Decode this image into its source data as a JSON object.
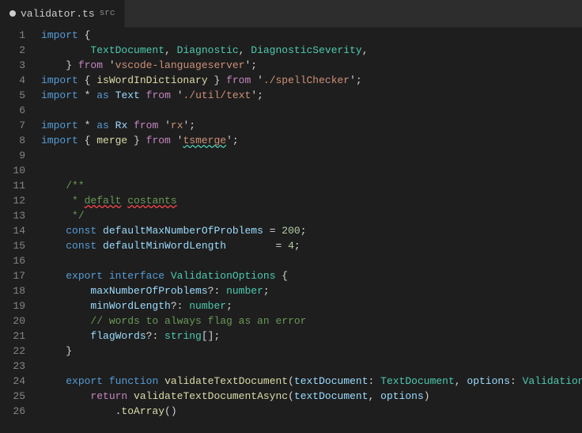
{
  "tab": {
    "dot": true,
    "filename": "validator.ts",
    "src_label": "src"
  },
  "lines": [
    {
      "num": 1,
      "tokens": [
        {
          "t": "kw",
          "v": "import"
        },
        {
          "t": "plain",
          "v": " { "
        }
      ]
    },
    {
      "num": 2,
      "tokens": [
        {
          "t": "plain",
          "v": "        "
        },
        {
          "t": "type",
          "v": "TextDocument"
        },
        {
          "t": "plain",
          "v": ", "
        },
        {
          "t": "type",
          "v": "Diagnostic"
        },
        {
          "t": "plain",
          "v": ", "
        },
        {
          "t": "type",
          "v": "DiagnosticSeverity"
        },
        {
          "t": "plain",
          "v": ","
        }
      ]
    },
    {
      "num": 3,
      "tokens": [
        {
          "t": "plain",
          "v": "    } "
        },
        {
          "t": "kw2",
          "v": "from"
        },
        {
          "t": "plain",
          "v": " '"
        },
        {
          "t": "str",
          "v": "vscode-languageserver"
        },
        {
          "t": "plain",
          "v": "';"
        }
      ]
    },
    {
      "num": 4,
      "tokens": [
        {
          "t": "kw",
          "v": "import"
        },
        {
          "t": "plain",
          "v": " { "
        },
        {
          "t": "fn",
          "v": "isWordInDictionary"
        },
        {
          "t": "plain",
          "v": " } "
        },
        {
          "t": "kw2",
          "v": "from"
        },
        {
          "t": "plain",
          "v": " '"
        },
        {
          "t": "str",
          "v": "./spellChecker"
        },
        {
          "t": "plain",
          "v": "';"
        }
      ]
    },
    {
      "num": 5,
      "tokens": [
        {
          "t": "kw",
          "v": "import"
        },
        {
          "t": "plain",
          "v": " * "
        },
        {
          "t": "kw",
          "v": "as"
        },
        {
          "t": "plain",
          "v": " "
        },
        {
          "t": "id",
          "v": "Text"
        },
        {
          "t": "plain",
          "v": " "
        },
        {
          "t": "kw2",
          "v": "from"
        },
        {
          "t": "plain",
          "v": " '"
        },
        {
          "t": "str",
          "v": "./util/text"
        },
        {
          "t": "plain",
          "v": "';"
        }
      ]
    },
    {
      "num": 6,
      "tokens": []
    },
    {
      "num": 7,
      "tokens": [
        {
          "t": "kw",
          "v": "import"
        },
        {
          "t": "plain",
          "v": " * "
        },
        {
          "t": "kw",
          "v": "as"
        },
        {
          "t": "plain",
          "v": " "
        },
        {
          "t": "id",
          "v": "Rx"
        },
        {
          "t": "plain",
          "v": " "
        },
        {
          "t": "kw2",
          "v": "from"
        },
        {
          "t": "plain",
          "v": " '"
        },
        {
          "t": "str",
          "v": "rx"
        },
        {
          "t": "plain",
          "v": "';"
        }
      ]
    },
    {
      "num": 8,
      "tokens": [
        {
          "t": "kw",
          "v": "import"
        },
        {
          "t": "plain",
          "v": " { "
        },
        {
          "t": "fn",
          "v": "merge"
        },
        {
          "t": "plain",
          "v": " } "
        },
        {
          "t": "kw2",
          "v": "from"
        },
        {
          "t": "plain",
          "v": " '"
        },
        {
          "t": "str",
          "v": "tsmerge",
          "squig": "green"
        },
        {
          "t": "plain",
          "v": "';"
        }
      ]
    },
    {
      "num": 9,
      "tokens": []
    },
    {
      "num": 10,
      "tokens": []
    },
    {
      "num": 11,
      "tokens": [
        {
          "t": "plain",
          "v": "    "
        },
        {
          "t": "comment",
          "v": "/**"
        }
      ]
    },
    {
      "num": 12,
      "tokens": [
        {
          "t": "plain",
          "v": "    "
        },
        {
          "t": "comment",
          "v": " * "
        },
        {
          "t": "comment",
          "v": "defalt",
          "squig": "red"
        },
        {
          "t": "plain",
          "v": " "
        },
        {
          "t": "comment",
          "v": "costants",
          "squig": "red"
        }
      ]
    },
    {
      "num": 13,
      "tokens": [
        {
          "t": "plain",
          "v": "    "
        },
        {
          "t": "comment",
          "v": " */"
        }
      ]
    },
    {
      "num": 14,
      "tokens": [
        {
          "t": "plain",
          "v": "    "
        },
        {
          "t": "kw",
          "v": "const"
        },
        {
          "t": "plain",
          "v": " "
        },
        {
          "t": "id",
          "v": "defaultMaxNumberOfProblems"
        },
        {
          "t": "plain",
          "v": " = "
        },
        {
          "t": "num",
          "v": "200"
        },
        {
          "t": "plain",
          "v": ";"
        }
      ]
    },
    {
      "num": 15,
      "tokens": [
        {
          "t": "plain",
          "v": "    "
        },
        {
          "t": "kw",
          "v": "const"
        },
        {
          "t": "plain",
          "v": " "
        },
        {
          "t": "id",
          "v": "defaultMinWordLength"
        },
        {
          "t": "plain",
          "v": "        = "
        },
        {
          "t": "num",
          "v": "4"
        },
        {
          "t": "plain",
          "v": ";"
        }
      ]
    },
    {
      "num": 16,
      "tokens": []
    },
    {
      "num": 17,
      "tokens": [
        {
          "t": "plain",
          "v": "    "
        },
        {
          "t": "kw",
          "v": "export"
        },
        {
          "t": "plain",
          "v": " "
        },
        {
          "t": "kw",
          "v": "interface"
        },
        {
          "t": "plain",
          "v": " "
        },
        {
          "t": "type",
          "v": "ValidationOptions"
        },
        {
          "t": "plain",
          "v": " {"
        }
      ]
    },
    {
      "num": 18,
      "tokens": [
        {
          "t": "plain",
          "v": "        "
        },
        {
          "t": "id",
          "v": "maxNumberOfProblems"
        },
        {
          "t": "plain",
          "v": "?: "
        },
        {
          "t": "type",
          "v": "number"
        },
        {
          "t": "plain",
          "v": ";"
        }
      ]
    },
    {
      "num": 19,
      "tokens": [
        {
          "t": "plain",
          "v": "        "
        },
        {
          "t": "id",
          "v": "minWordLength"
        },
        {
          "t": "plain",
          "v": "?: "
        },
        {
          "t": "type",
          "v": "number"
        },
        {
          "t": "plain",
          "v": ";"
        }
      ]
    },
    {
      "num": 20,
      "tokens": [
        {
          "t": "plain",
          "v": "        "
        },
        {
          "t": "comment",
          "v": "// words to always flag as an error"
        }
      ]
    },
    {
      "num": 21,
      "tokens": [
        {
          "t": "plain",
          "v": "        "
        },
        {
          "t": "id",
          "v": "flagWords"
        },
        {
          "t": "plain",
          "v": "?: "
        },
        {
          "t": "type",
          "v": "string"
        },
        {
          "t": "plain",
          "v": "[];"
        }
      ]
    },
    {
      "num": 22,
      "tokens": [
        {
          "t": "plain",
          "v": "    }"
        }
      ]
    },
    {
      "num": 23,
      "tokens": []
    },
    {
      "num": 24,
      "tokens": [
        {
          "t": "plain",
          "v": "    "
        },
        {
          "t": "kw",
          "v": "export"
        },
        {
          "t": "plain",
          "v": " "
        },
        {
          "t": "kw",
          "v": "function"
        },
        {
          "t": "plain",
          "v": " "
        },
        {
          "t": "fn",
          "v": "validateTextDocument"
        },
        {
          "t": "plain",
          "v": "("
        },
        {
          "t": "id",
          "v": "textDocument"
        },
        {
          "t": "plain",
          "v": ": "
        },
        {
          "t": "type",
          "v": "TextDocument"
        },
        {
          "t": "plain",
          "v": ", "
        },
        {
          "t": "id",
          "v": "options"
        },
        {
          "t": "plain",
          "v": ": "
        },
        {
          "t": "type",
          "v": "ValidationOpti"
        }
      ]
    },
    {
      "num": 25,
      "tokens": [
        {
          "t": "plain",
          "v": "        "
        },
        {
          "t": "kw2",
          "v": "return"
        },
        {
          "t": "plain",
          "v": " "
        },
        {
          "t": "fn",
          "v": "validateTextDocumentAsync"
        },
        {
          "t": "plain",
          "v": "("
        },
        {
          "t": "id",
          "v": "textDocument"
        },
        {
          "t": "plain",
          "v": ", "
        },
        {
          "t": "id",
          "v": "options"
        },
        {
          "t": "plain",
          "v": ")"
        }
      ]
    },
    {
      "num": 26,
      "tokens": [
        {
          "t": "plain",
          "v": "            ."
        },
        {
          "t": "fn",
          "v": "toArray"
        },
        {
          "t": "plain",
          "v": "()"
        }
      ]
    }
  ]
}
